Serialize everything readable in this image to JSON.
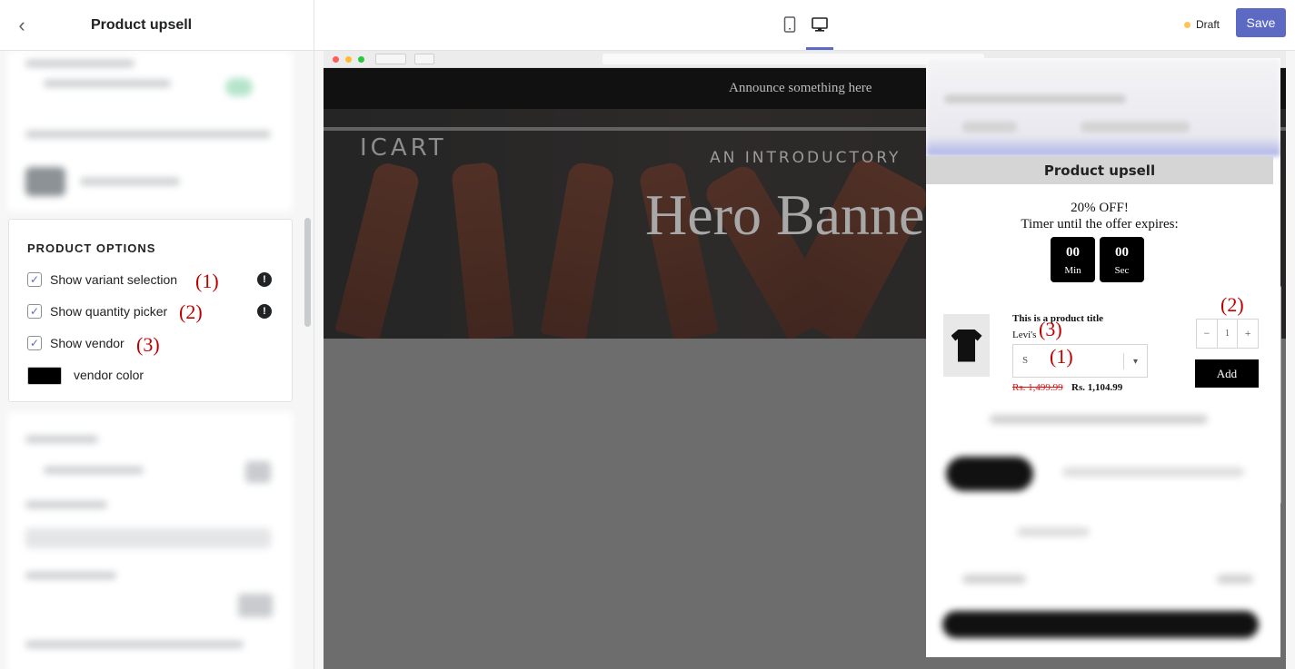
{
  "header": {
    "title": "Product upsell",
    "draft_label": "Draft",
    "save_label": "Save",
    "back_icon": "chevron-left-icon",
    "devices": [
      "mobile-icon",
      "desktop-icon"
    ],
    "accent_color": "#5c6ac4"
  },
  "product_options": {
    "heading": "PRODUCT OPTIONS",
    "options": [
      {
        "label": "Show variant selection",
        "checked": true,
        "annotation": "(1)",
        "has_info": true
      },
      {
        "label": "Show quantity picker",
        "checked": true,
        "annotation": "(2)",
        "has_info": true
      },
      {
        "label": "Show vendor",
        "checked": true,
        "annotation": "(3)",
        "has_info": false
      }
    ],
    "vendor_color_label": "vendor color",
    "vendor_color": "#000000"
  },
  "preview": {
    "announcement": "Announce something here",
    "logo": "ICART",
    "hero_subtitle": "AN INTRODUCTORY",
    "hero_title": "Hero Banne"
  },
  "upsell": {
    "header": "Product upsell",
    "offer_line1": "20% OFF!",
    "offer_line2": "Timer until the offer expires:",
    "timer": [
      {
        "value": "00",
        "unit": "Min"
      },
      {
        "value": "00",
        "unit": "Sec"
      }
    ],
    "product_title": "This is a product title",
    "vendor": "Levi's",
    "variant_value": "S",
    "old_price": "Rs. 1,499.99",
    "new_price": "Rs. 1,104.99",
    "quantity": "1",
    "minus": "−",
    "plus": "+",
    "add_label": "Add",
    "annotations": {
      "variant": "(1)",
      "quantity": "(2)",
      "vendor": "(3)"
    }
  }
}
